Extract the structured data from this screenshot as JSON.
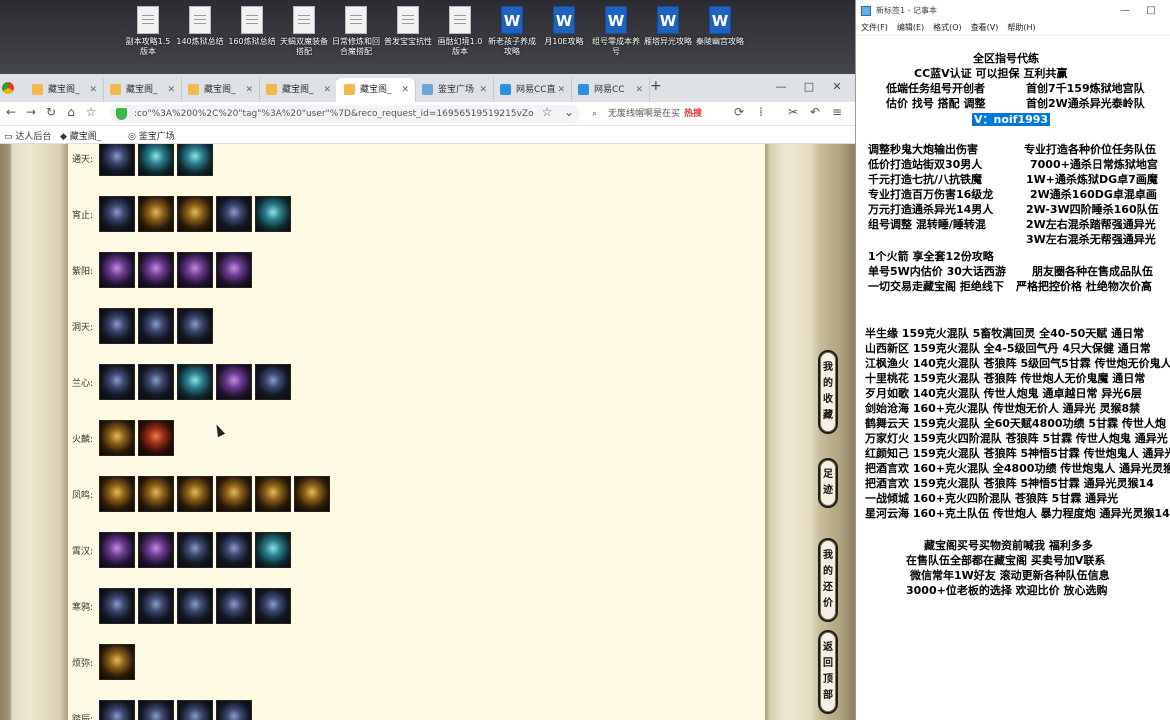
{
  "desktop": {
    "icons": [
      {
        "label": "副本攻略1.5版本",
        "type": "doc"
      },
      {
        "label": "140炼狱总结",
        "type": "doc"
      },
      {
        "label": "160炼狱总结",
        "type": "doc"
      },
      {
        "label": "天蝎双魔装备搭配",
        "type": "doc"
      },
      {
        "label": "日常修炼和回合魔搭配",
        "type": "doc"
      },
      {
        "label": "普发宝宝抗性",
        "type": "doc"
      },
      {
        "label": "画骷幻境1.0版本",
        "type": "doc"
      },
      {
        "label": "新老孩子养成攻略",
        "type": "word"
      },
      {
        "label": "月10E攻略",
        "type": "word"
      },
      {
        "label": "组号零成本养号",
        "type": "word"
      },
      {
        "label": "雁塔异光攻略",
        "type": "word"
      },
      {
        "label": "秦陵幽宫攻略",
        "type": "word"
      }
    ]
  },
  "browser": {
    "tabs": [
      {
        "label": "藏宝阁_"
      },
      {
        "label": "藏宝阁_"
      },
      {
        "label": "藏宝阁_"
      },
      {
        "label": "藏宝阁_"
      },
      {
        "label": "藏宝阁_"
      },
      {
        "label": "鉴宝广场"
      },
      {
        "label": "网易CC直"
      },
      {
        "label": "网易CC"
      }
    ],
    "url": ":co\"%3A%200%2C%20\"tag\"%3A%20\"user\"%7D&reco_request_id=16956519519215vZo",
    "search_text": "无废线帽啊是在买",
    "search_badge": "热搜",
    "bookmarks": [
      "达人后台",
      "藏宝阁_",
      "鉴宝广场"
    ],
    "window_buttons": [
      "—",
      "□",
      "✕"
    ],
    "new_tab": "+"
  },
  "page": {
    "rows": [
      {
        "label": "通天:",
        "items": [
          "b",
          "c",
          "c"
        ]
      },
      {
        "label": "宵止:",
        "items": [
          "b",
          "g",
          "g",
          "b",
          "c"
        ]
      },
      {
        "label": "紫阳:",
        "items": [
          "p",
          "p",
          "p",
          "p"
        ]
      },
      {
        "label": "洞天:",
        "items": [
          "b",
          "b",
          "b"
        ]
      },
      {
        "label": "兰心:",
        "items": [
          "b",
          "b",
          "c",
          "p",
          "b"
        ]
      },
      {
        "label": "火麟:",
        "items": [
          "g",
          "r"
        ]
      },
      {
        "label": "凤鸣:",
        "items": [
          "g",
          "g",
          "g",
          "g",
          "g",
          "g"
        ]
      },
      {
        "label": "霄汉:",
        "items": [
          "p",
          "p",
          "b",
          "b",
          "c"
        ]
      },
      {
        "label": "寒鸦:",
        "items": [
          "b",
          "b",
          "b",
          "b",
          "b"
        ]
      },
      {
        "label": "烦弥:",
        "items": [
          "g"
        ]
      },
      {
        "label": "踏辰:",
        "items": [
          "b",
          "b",
          "b",
          "b"
        ]
      }
    ],
    "side_buttons": [
      {
        "label": "我的收藏",
        "chars": [
          "我",
          "的",
          "收",
          "藏"
        ]
      },
      {
        "label": "足迹",
        "chars": [
          "足",
          "迹"
        ]
      },
      {
        "label": "我的还价",
        "chars": [
          "我",
          "的",
          "还",
          "价"
        ]
      },
      {
        "label": "返回顶部",
        "chars": [
          "返",
          "回",
          "顶",
          "部"
        ]
      }
    ]
  },
  "notepad": {
    "title": "新标签1 - 记事本",
    "menu": [
      "文件(F)",
      "编辑(E)",
      "格式(O)",
      "查看(V)",
      "帮助(H)"
    ],
    "lines": [
      "全区指号代练",
      "CC蓝V认证 可以担保 互利共赢",
      "低端任务组号开创者",
      "首创7千159炼狱地宫队",
      "估价 找号 搭配 调整",
      "首创2W通杀异光泰岭队",
      "V：noif1993",
      "调整秒鬼大炮输出伤害",
      "专业打造各种价位任务队伍",
      "低价打造站街双30男人",
      "7000+通杀日常炼狱地宫",
      "千元打造七抗/八抗铁魔",
      "1W+通杀炼狱DG卓7画魔",
      "专业打造百万伤害16级龙",
      "2W通杀160DG卓混卓画",
      "万元打造通杀异光14男人",
      "2W-3W四阶睡杀160队伍",
      "组号调整 混转睡/睡转混",
      "2W左右混杀踏帮强通异光",
      "3W左右混杀无帮强通异光",
      "1个火箭 享全套12份攻略",
      "单号5W内估价 30大话西游",
      "朋友圈各种在售成品队伍",
      "一切交易走藏宝阁 拒绝线下",
      "严格把控价格 杜绝物次价高",
      "半生缘    159克火混队 5畜牧满回灵 全40-50天赋 通日常",
      "山西新区 159克火混队 全4-5级回气丹 4只大保健 通日常",
      "江枫渔火 140克火混队 苍狼阵 5级回气5甘霖 传世炮无价鬼人",
      "十里桃花 159克火混队 苍狼阵 传世炮人无价鬼魔 通日常",
      "歹月如歌 140克火混队 传世人炮鬼 通卓越日常 异光6层",
      "剑始沧海 160+克火混队 传世炮无价人 通异光 灵猴8禁",
      "鹤舞云天 159克火混队 全60天赋4800功绩 5甘霖 传世人炮",
      "万家灯火 159克火四阶混队 苍狼阵 5甘霖 传世人炮鬼 通异光",
      "红颜知己 159克火混队 苍狼阵 5神悟5甘霖 传世炮鬼人 通异光",
      "把酒言欢 160+克火混队 全4800功绩 传世炮鬼人 通异光灵猴",
      "把酒言欢 159克火混队 苍狼阵 5神悟5甘霖 通异光灵猴14",
      "一战倾城 160+克火四阶混队 苍狼阵 5甘霖 通异光",
      "星河云海 160+克土队伍 传世炮人 暴力程度炮 通异光灵猴14",
      "藏宝阁买号买物资前喊我 福利多多",
      "在售队伍全部都在藏宝阁 买卖号加V联系",
      "微信常年1W好友 滚动更新各种队伍信息",
      "3000+位老板的选择 欢迎比价 放心选购"
    ]
  },
  "colors": {
    "selection": "#0078d7",
    "content_bg": "#fdf9e2",
    "frame": "#b8ab86"
  }
}
